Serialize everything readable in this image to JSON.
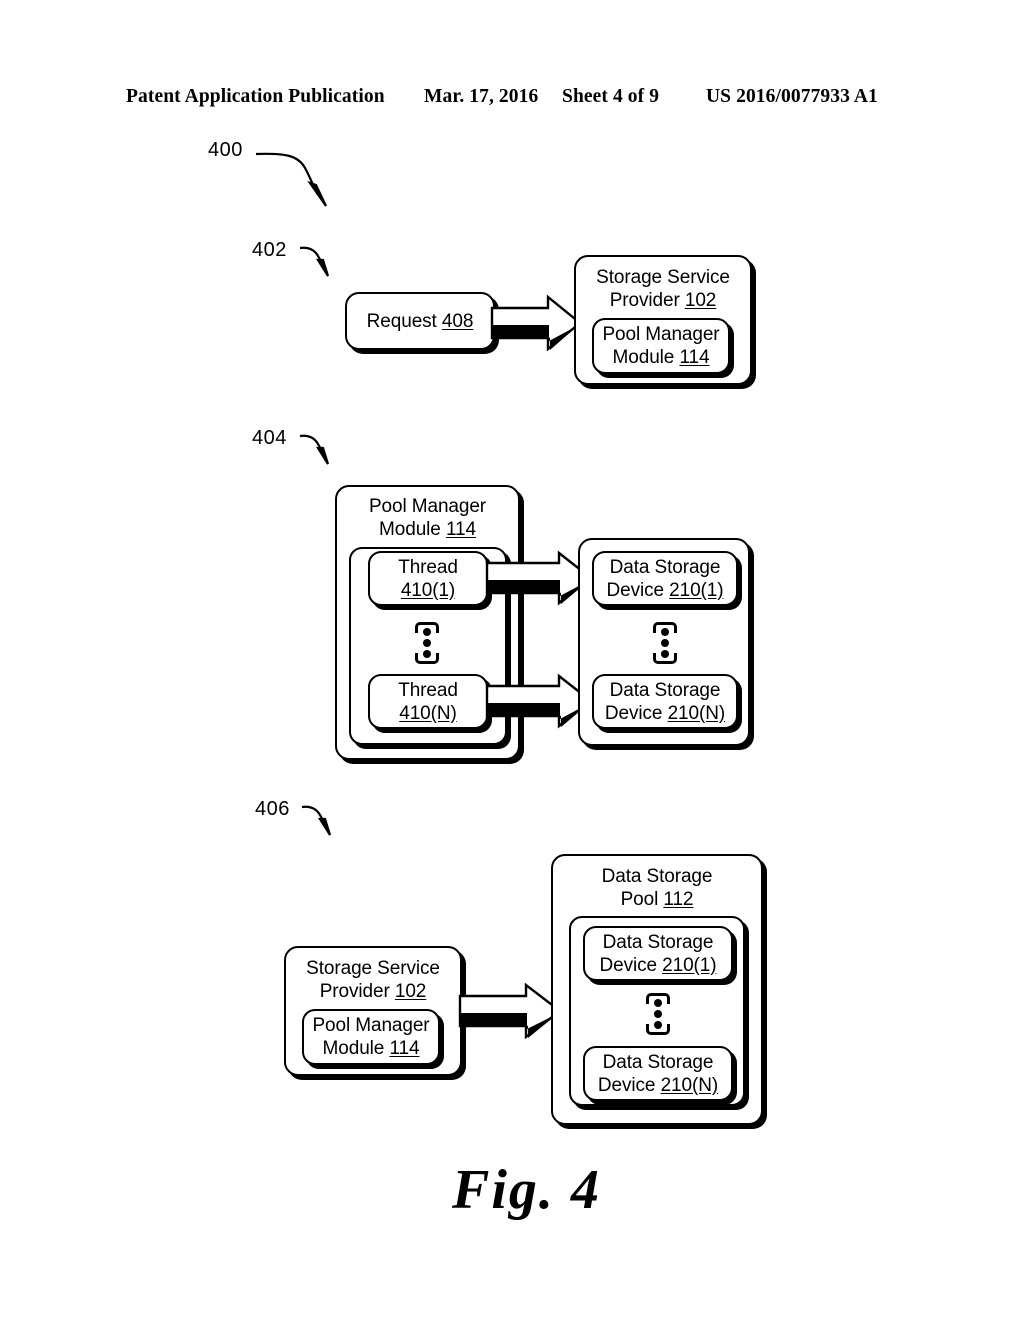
{
  "header": {
    "publication": "Patent Application Publication",
    "date": "Mar. 17, 2016",
    "sheet": "Sheet 4 of 9",
    "patent_number": "US 2016/0077933 A1"
  },
  "figure": {
    "caption": "Fig. 4",
    "diagram_number": "400"
  },
  "stages": [
    {
      "ref": "402",
      "boxes": {
        "request": {
          "line1": "Request ",
          "ref": "408"
        },
        "storage_service_provider": {
          "line1": "Storage Service",
          "line2": "Provider ",
          "ref": "102"
        },
        "pool_manager_module": {
          "line1": "Pool Manager",
          "line2": "Module ",
          "ref": "114"
        }
      },
      "arrow": "block-arrow-right"
    },
    {
      "ref": "404",
      "boxes": {
        "pool_manager_module": {
          "line1": "Pool Manager",
          "line2": "Module ",
          "ref": "114"
        },
        "thread_1": {
          "line1": "Thread",
          "line2": "410(1)"
        },
        "thread_n": {
          "line1": "Thread",
          "line2": "410(N)"
        },
        "data_storage_device_1": {
          "line1": "Data Storage",
          "line2": "Device ",
          "ref": "210(1)"
        },
        "data_storage_device_n": {
          "line1": "Data Storage",
          "line2": "Device ",
          "ref": "210(N)"
        }
      },
      "ellipsis": "vertical-ellipsis",
      "arrows": [
        "block-arrow-right",
        "block-arrow-right"
      ]
    },
    {
      "ref": "406",
      "boxes": {
        "storage_service_provider": {
          "line1": "Storage Service",
          "line2": "Provider ",
          "ref": "102"
        },
        "pool_manager_module": {
          "line1": "Pool Manager",
          "line2": "Module ",
          "ref": "114"
        },
        "data_storage_pool": {
          "line1": "Data Storage",
          "line2": "Pool ",
          "ref": "112"
        },
        "data_storage_device_1": {
          "line1": "Data Storage",
          "line2": "Device ",
          "ref": "210(1)"
        },
        "data_storage_device_n": {
          "line1": "Data Storage",
          "line2": "Device ",
          "ref": "210(N)"
        }
      },
      "ellipsis": "vertical-ellipsis",
      "arrow": "block-arrow-right"
    }
  ],
  "colors": {
    "ink": "#000000",
    "paper": "#ffffff"
  }
}
